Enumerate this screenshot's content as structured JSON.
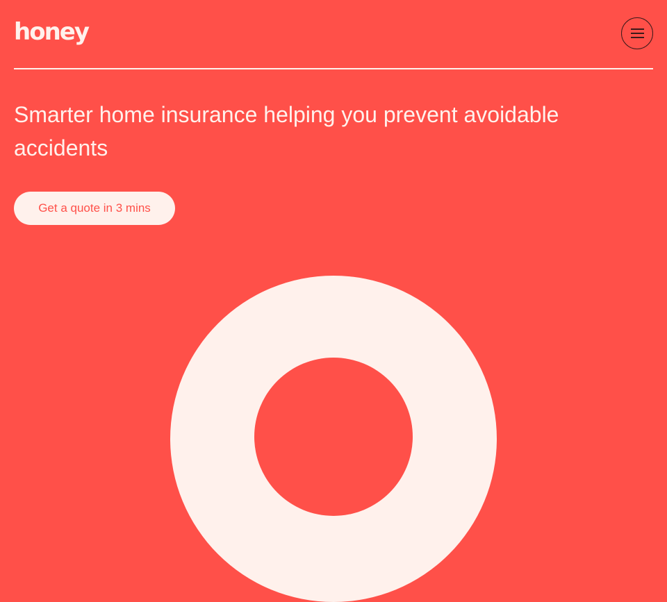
{
  "brand": {
    "logo_text": "honey"
  },
  "nav": {
    "menu_icon": "hamburger-menu-icon"
  },
  "hero": {
    "headline": "Smarter home insurance helping you prevent avoidable accidents",
    "cta_label": "Get a quote in 3 mins"
  },
  "theme": {
    "background": "#ff5049",
    "foreground": "#fff1ec",
    "icon_stroke": "#3a1a1a"
  }
}
